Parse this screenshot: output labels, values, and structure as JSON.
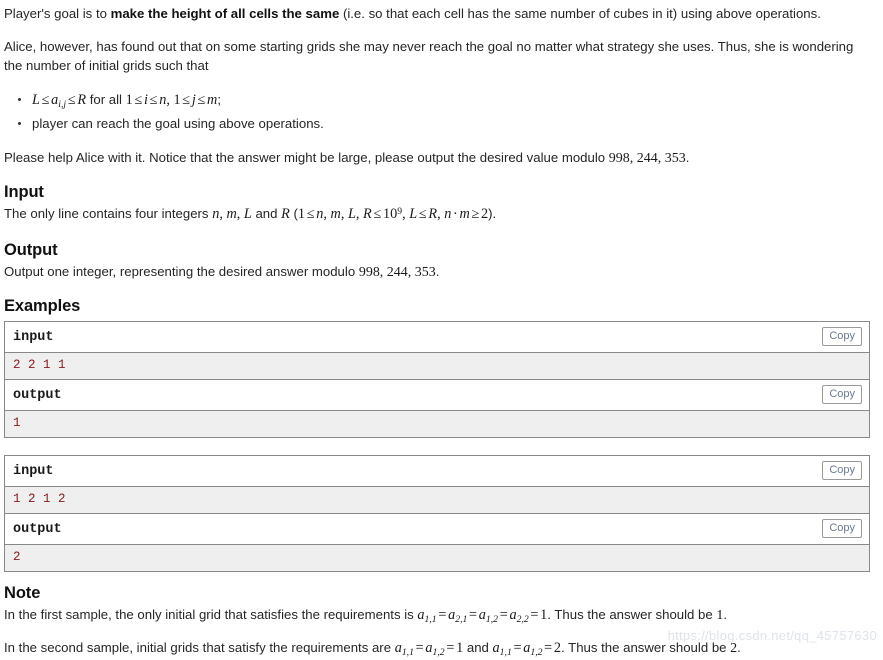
{
  "statement": {
    "goal_paragraph": {
      "lead": "Player's goal is to ",
      "bold": "make the height of all cells the same",
      "tail": " (i.e. so that each cell has the same number of cubes in it) using above operations."
    },
    "alice_paragraph": "Alice, however, has found out that on some starting grids she may never reach the goal no matter what strategy she uses. Thus, she is wondering the number of initial grids such that",
    "bullets": [
      {
        "math_prefix": "L ≤ a_{i,j} ≤ R",
        "text_middle": " for all ",
        "math_suffix": "1 ≤ i ≤ n, 1 ≤ j ≤ m",
        "text_end": ";"
      },
      {
        "text": "player can reach the goal using above operations."
      }
    ],
    "modulo_paragraph": {
      "lead": "Please help Alice with it. Notice that the answer might be large, please output the desired value modulo ",
      "modulo": "998, 244, 353",
      "tail": "."
    }
  },
  "sections": {
    "input": {
      "heading": "Input",
      "lead": "The only line contains four integers ",
      "vars": "n, m, L",
      "and_word": " and ",
      "var_r": "R",
      "constraint_open": " (",
      "constraint": "1 ≤ n, m, L, R ≤ 10⁹, L ≤ R, n · m ≥ 2",
      "constraint_close": ")."
    },
    "output": {
      "heading": "Output",
      "lead": "Output one integer, representing the desired answer modulo ",
      "modulo": "998, 244, 353",
      "tail": "."
    },
    "examples": {
      "heading": "Examples"
    },
    "note": {
      "heading": "Note",
      "paragraph1": {
        "lead": "In the first sample, the only initial grid that satisfies the requirements is ",
        "math": "a_{1,1} = a_{2,1} = a_{1,2} = a_{2,2} = 1",
        "middle": ". Thus the answer should be ",
        "value": "1",
        "tail": "."
      },
      "paragraph2": {
        "lead": "In the second sample, initial grids that satisfy the requirements are ",
        "math1": "a_{1,1} = a_{1,2} = 1",
        "and_word": " and ",
        "math2": "a_{1,1} = a_{1,2} = 2",
        "middle": ". Thus the answer should be ",
        "value": "2",
        "tail": "."
      }
    }
  },
  "sample_tests": [
    {
      "input_label": "input",
      "input_copy_label": "Copy",
      "input_data": "2 2 1 1",
      "output_label": "output",
      "output_copy_label": "Copy",
      "output_data": "1"
    },
    {
      "input_label": "input",
      "input_copy_label": "Copy",
      "input_data": "1 2 1 2",
      "output_label": "output",
      "output_copy_label": "Copy",
      "output_data": "2"
    }
  ],
  "watermark": {
    "text": "https://blog.csdn.net/qq_45757630"
  },
  "colors": {
    "text": "#262626",
    "heading": "#111111",
    "sample_data": "#8b1a1a",
    "sample_bg": "#efefef",
    "border": "#888888",
    "copy_text": "#6b7a90"
  }
}
